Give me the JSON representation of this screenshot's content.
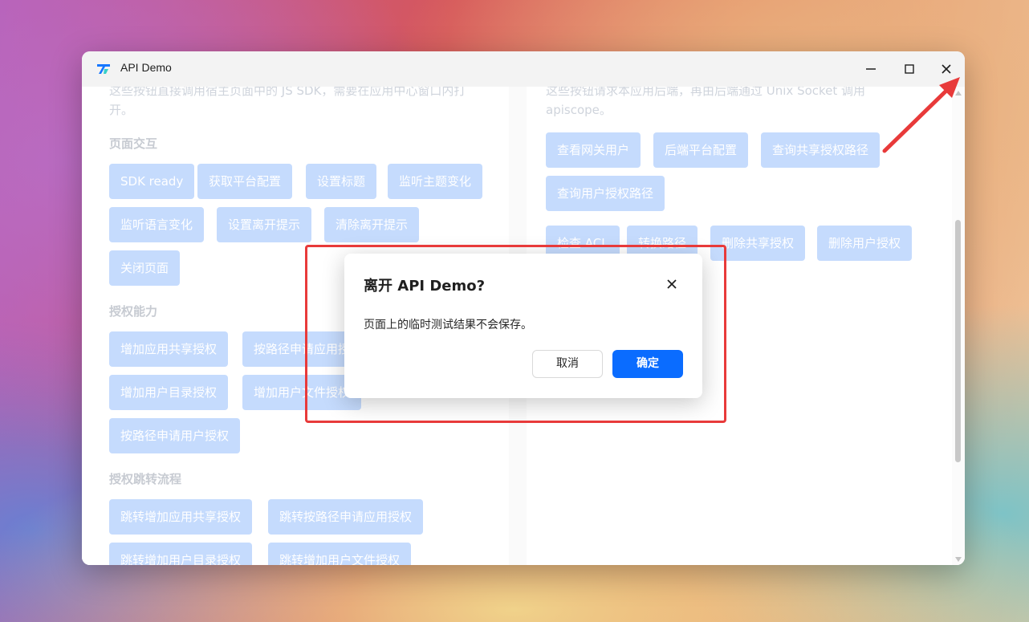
{
  "window": {
    "title": "API Demo",
    "accent": "#0a6cff"
  },
  "left_panel": {
    "desc_line1": "这些按钮直接调用宿主页面中的 JS SDK，需要在应用中心窗口内打",
    "desc_line2": "开。",
    "sections": [
      {
        "title": "页面交互",
        "buttons": [
          "SDK ready",
          "获取平台配置",
          "设置标题",
          "监听主题变化",
          "监听语言变化",
          "设置离开提示",
          "清除离开提示",
          "关闭页面"
        ]
      },
      {
        "title": "授权能力",
        "buttons": [
          "增加应用共享授权",
          "按路径申请应用授权",
          "增加用户目录授权",
          "增加用户文件授权",
          "按路径申请用户授权"
        ]
      },
      {
        "title": "授权跳转流程",
        "buttons": [
          "跳转增加应用共享授权",
          "跳转按路径申请应用授权",
          "跳转增加用户目录授权",
          "跳转增加用户文件授权"
        ]
      }
    ]
  },
  "right_panel": {
    "desc_line1": "这些按钮请求本应用后端，再由后端通过 Unix Socket 调用",
    "desc_line2": "apiscope。",
    "buttons": [
      "查看网关用户",
      "后端平台配置",
      "查询共享授权路径",
      "查询用户授权路径",
      "检查 ACL",
      "转换路径",
      "删除共享授权",
      "删除用户授权"
    ]
  },
  "dialog": {
    "title": "离开 API Demo?",
    "message": "页面上的临时测试结果不会保存。",
    "cancel_label": "取消",
    "ok_label": "确定"
  },
  "icons": {
    "app": "app-logo-icon",
    "minimize": "minimize-icon",
    "maximize": "maximize-icon",
    "close": "close-icon",
    "dialog_close": "close-icon"
  },
  "annotation_color": "#e83a3a"
}
